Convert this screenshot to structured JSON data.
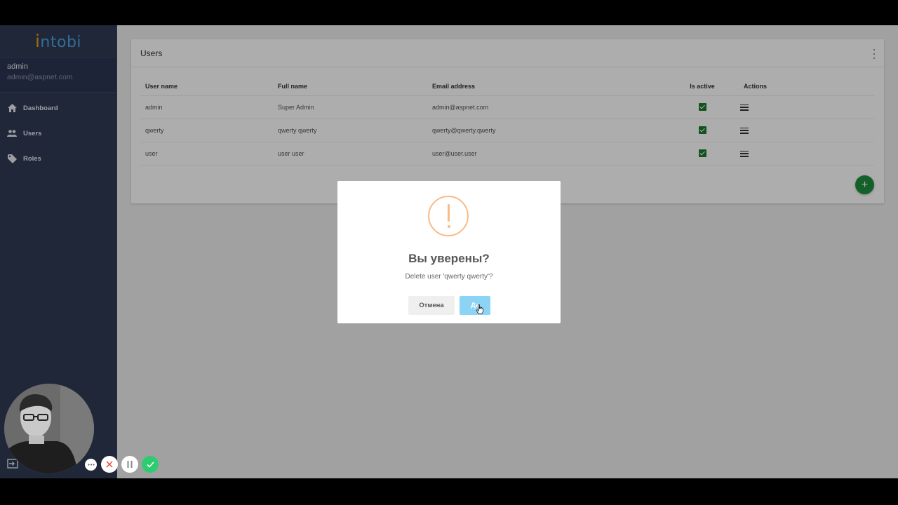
{
  "app": {
    "logo_text": "intobi",
    "logo_initial": "i"
  },
  "user": {
    "name": "admin",
    "email": "admin@aspnet.com"
  },
  "sidebar": {
    "items": [
      {
        "label": "Dashboard",
        "icon": "home-icon"
      },
      {
        "label": "Users",
        "icon": "users-icon"
      },
      {
        "label": "Roles",
        "icon": "tag-icon"
      }
    ]
  },
  "card": {
    "title": "Users",
    "columns": [
      "User name",
      "Full name",
      "Email address",
      "Is active",
      "Actions"
    ],
    "rows": [
      {
        "username": "admin",
        "fullname": "Super Admin",
        "email": "admin@aspnet.com",
        "active": true
      },
      {
        "username": "qwerty",
        "fullname": "qwerty qwerty",
        "email": "qwerty@qwerty.qwerty",
        "active": true
      },
      {
        "username": "user",
        "fullname": "user user",
        "email": "user@user.user",
        "active": true
      }
    ],
    "add_button": "+"
  },
  "dialog": {
    "title": "Вы уверены?",
    "text": "Delete user 'qwerty qwerty'?",
    "cancel_label": "Отмена",
    "confirm_label": "Да",
    "icon": "warning-icon",
    "icon_color": "#f8bb86",
    "confirm_color": "#8cd4f5"
  },
  "colors": {
    "sidebar": "#2e3a55",
    "active_check": "#1b7a2e",
    "add_button": "#1e8e3e",
    "recorder_done": "#2ecc71"
  },
  "recorder": {
    "buttons": [
      "more-icon",
      "cancel-icon",
      "pause-icon",
      "check-icon"
    ]
  }
}
